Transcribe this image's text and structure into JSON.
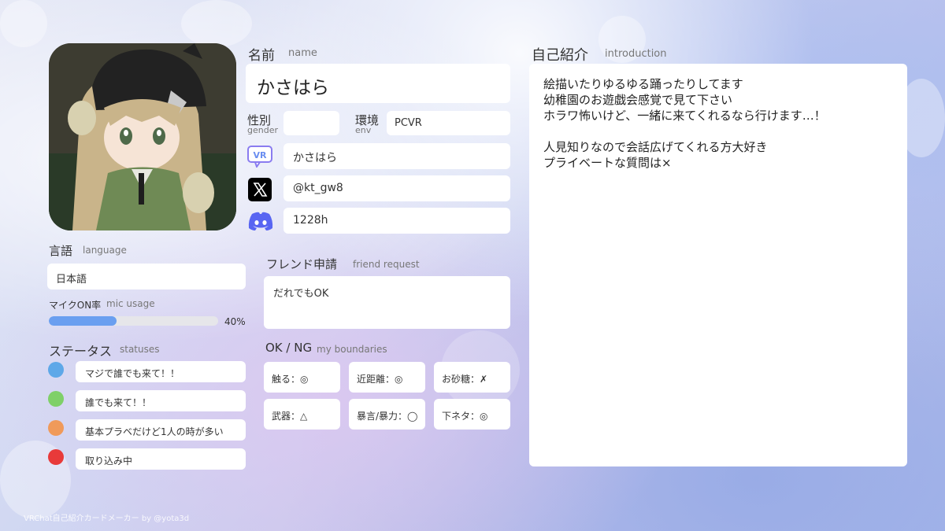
{
  "profile": {
    "name_label": "名前",
    "name_label_en": "name",
    "name_value": "かさはら",
    "gender_label": "性別",
    "gender_label_en": "gender",
    "gender_value": "",
    "env_label": "環境",
    "env_label_en": "env",
    "env_value": "PCVR",
    "vrchat_icon": "vrchat-icon",
    "vrchat_value": "かさはら",
    "x_icon": "x-logo-icon",
    "x_value": "@kt_gw8",
    "discord_icon": "discord-icon",
    "discord_value": "1228h"
  },
  "language": {
    "label": "言語",
    "label_en": "language",
    "value": "日本語"
  },
  "mic": {
    "label": "マイクON率",
    "label_en": "mic usage",
    "percent_text": "40%",
    "percent": 40,
    "bar_color": "#6a9ff0"
  },
  "statuses": {
    "label": "ステータス",
    "label_en": "statuses",
    "items": [
      {
        "color": "#5ea8e8",
        "text": "マジで誰でも来て！！"
      },
      {
        "color": "#7fd068",
        "text": "誰でも来て！！"
      },
      {
        "color": "#f09a5a",
        "text": "基本プラベだけど1人の時が多い"
      },
      {
        "color": "#e83a3a",
        "text": "取り込み中"
      }
    ]
  },
  "friend_request": {
    "label": "フレンド申請",
    "label_en": "friend request",
    "value": "だれでもOK"
  },
  "boundaries": {
    "label": "OK / NG",
    "label_en": "my boundaries",
    "items": [
      "触る：◎",
      "近距離：◎",
      "お砂糖：✗",
      "武器：△",
      "暴言/暴力：◯",
      "下ネタ：◎"
    ]
  },
  "introduction": {
    "label": "自己紹介",
    "label_en": "introduction",
    "lines": [
      "絵描いたりゆるゆる踊ったりしてます",
      "幼稚園のお遊戯会感覚で見て下さい",
      "ホラワ怖いけど、一緒に来てくれるなら行けます…！",
      "",
      "人見知りなので会話広げてくれる方大好き",
      "プライベートな質問は×"
    ]
  },
  "footer": {
    "credit": "VRChat自己紹介カードメーカー by @yota3d"
  }
}
